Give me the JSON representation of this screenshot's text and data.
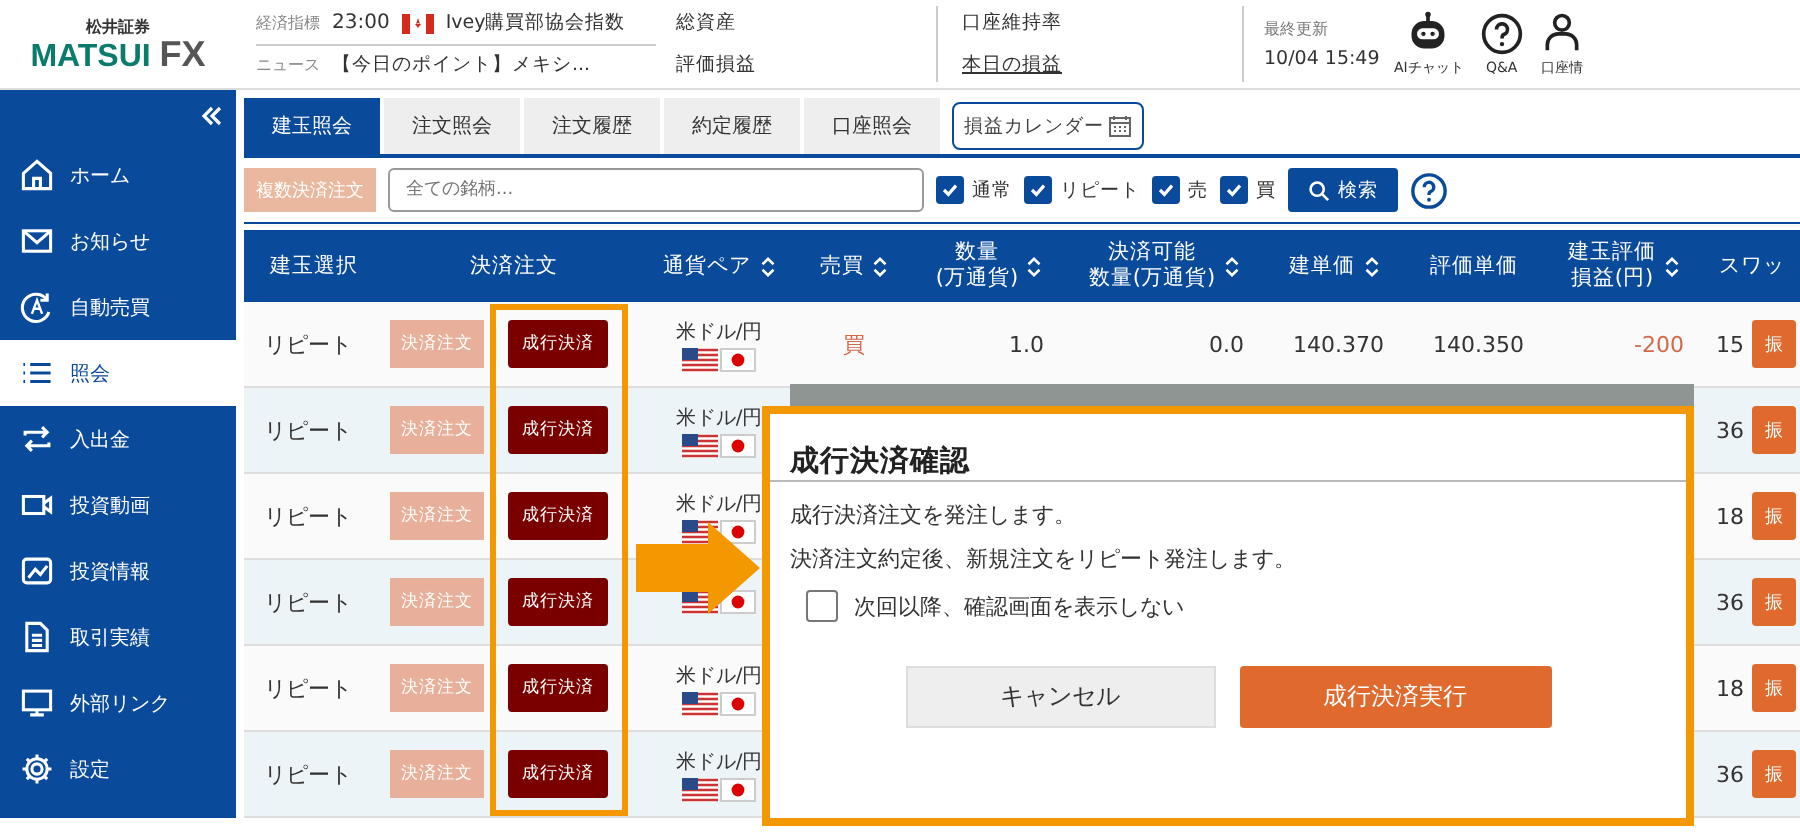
{
  "header": {
    "brand_top": "松井証券",
    "brand_main": "MATSUI",
    "brand_fx": "FX",
    "indicator": {
      "label": "経済指標",
      "time": "23:00",
      "title": "Ivey購買部協会指数"
    },
    "news": {
      "label": "ニュース",
      "title": "【今日のポイント】メキシ..."
    },
    "summary": [
      {
        "label": "総資産",
        "link": false
      },
      {
        "label": "評価損益",
        "link": false
      }
    ],
    "summary2": [
      {
        "label": "口座維持率",
        "link": false
      },
      {
        "label": "本日の損益",
        "link": true
      }
    ],
    "updated": {
      "label": "最終更新",
      "time": "10/04 15:49"
    },
    "tools": [
      {
        "kind": "robot",
        "label": "AIチャット"
      },
      {
        "kind": "question",
        "label": "Q&A"
      },
      {
        "kind": "person",
        "label": "口座情"
      }
    ]
  },
  "sidebar": {
    "items": [
      {
        "label": "ホーム",
        "selected": false
      },
      {
        "label": "お知らせ",
        "selected": false
      },
      {
        "label": "自動売買",
        "selected": false
      },
      {
        "label": "照会",
        "selected": true
      },
      {
        "label": "入出金",
        "selected": false
      },
      {
        "label": "投資動画",
        "selected": false
      },
      {
        "label": "投資情報",
        "selected": false
      },
      {
        "label": "取引実績",
        "selected": false
      },
      {
        "label": "外部リンク",
        "selected": false
      },
      {
        "label": "設定",
        "selected": false
      }
    ]
  },
  "tabs": [
    {
      "label": "建玉照会",
      "selected": true
    },
    {
      "label": "注文照会",
      "selected": false
    },
    {
      "label": "注文履歴",
      "selected": false
    },
    {
      "label": "約定履歴",
      "selected": false
    },
    {
      "label": "口座照会",
      "selected": false
    }
  ],
  "calendar_button": "損益カレンダー",
  "filter": {
    "bulk_button": "複数決済注文",
    "search": {
      "placeholder": "全ての銘柄..."
    },
    "checks": [
      {
        "label": "通常",
        "checked": true
      },
      {
        "label": "リピート",
        "checked": true
      },
      {
        "label": "売",
        "checked": true
      },
      {
        "label": "買",
        "checked": true
      }
    ],
    "search_button": "検索"
  },
  "table": {
    "columns": [
      {
        "lines": [
          "建玉選択"
        ],
        "sortable": false
      },
      {
        "lines": [
          "決済注文"
        ],
        "sortable": false
      },
      {
        "lines": [
          "通貨ペア"
        ],
        "sortable": true
      },
      {
        "lines": [
          "売買"
        ],
        "sortable": true
      },
      {
        "lines": [
          "数量",
          "(万通貨)"
        ],
        "sortable": true
      },
      {
        "lines": [
          "決済可能",
          "数量(万通貨)"
        ],
        "sortable": true
      },
      {
        "lines": [
          "建単価"
        ],
        "sortable": true
      },
      {
        "lines": [
          "評価単価"
        ],
        "sortable": false
      },
      {
        "lines": [
          "建玉評価",
          "損益(円)"
        ],
        "sortable": true
      },
      {
        "lines": [
          "スワッ"
        ],
        "sortable": false
      }
    ],
    "rows": [
      {
        "type": "リピート",
        "close_order": "決済注文",
        "market_close": "成行決済",
        "pair": "米ドル/円",
        "side": "買",
        "qty": "1.0",
        "closable": "0.0",
        "open_price": "140.370",
        "eval_price": "140.350",
        "pl": "-200",
        "swap": "15",
        "transfer": "振"
      },
      {
        "type": "リピート",
        "close_order": "決済注文",
        "market_close": "成行決済",
        "pair": "米ドル/円",
        "swap": "36",
        "transfer": "振"
      },
      {
        "type": "リピート",
        "close_order": "決済注文",
        "market_close": "成行決済",
        "pair": "米ドル/円",
        "swap": "18",
        "transfer": "振"
      },
      {
        "type": "リピート",
        "close_order": "決済注文",
        "market_close": "成行決済",
        "swap": "36",
        "transfer": "振"
      },
      {
        "type": "リピート",
        "close_order": "決済注文",
        "market_close": "成行決済",
        "pair": "米ドル/円",
        "swap": "18",
        "transfer": "振"
      },
      {
        "type": "リピート",
        "close_order": "決済注文",
        "market_close": "成行決済",
        "pair": "米ドル/円",
        "swap": "36",
        "transfer": "振"
      }
    ]
  },
  "dialog": {
    "title": "成行決済確認",
    "message": [
      "成行決済注文を発注します。",
      "決済注文約定後、新規注文をリピート発注します。"
    ],
    "dont_show": {
      "label": "次回以降、確認画面を表示しない",
      "checked": false
    },
    "cancel": "キャンセル",
    "confirm": "成行決済実行"
  }
}
